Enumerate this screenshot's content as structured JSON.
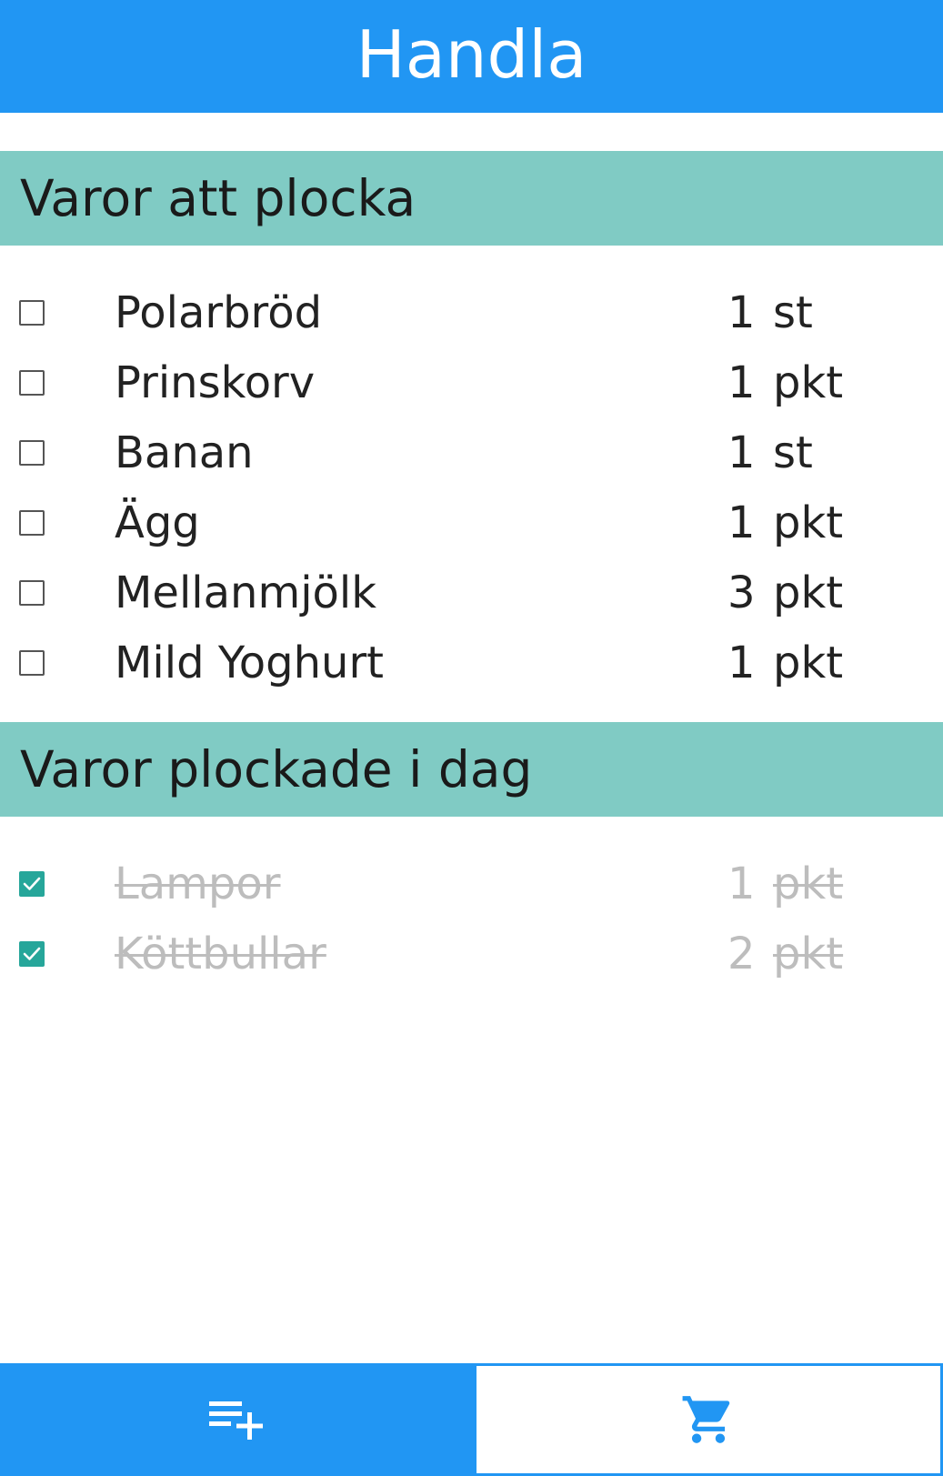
{
  "header": {
    "title": "Handla"
  },
  "to_pick": {
    "title": "Varor att plocka",
    "items": [
      {
        "name": "Polarbröd",
        "qty": "1",
        "unit": "st",
        "checked": false
      },
      {
        "name": "Prinskorv",
        "qty": "1",
        "unit": "pkt",
        "checked": false
      },
      {
        "name": "Banan",
        "qty": "1",
        "unit": "st",
        "checked": false
      },
      {
        "name": "Ägg",
        "qty": "1",
        "unit": "pkt",
        "checked": false
      },
      {
        "name": "Mellanmjölk",
        "qty": "3",
        "unit": "pkt",
        "checked": false
      },
      {
        "name": "Mild Yoghurt",
        "qty": "1",
        "unit": "pkt",
        "checked": false
      }
    ]
  },
  "picked_today": {
    "title": "Varor plockade i dag",
    "items": [
      {
        "name": "Lampor",
        "qty": "1",
        "unit": "pkt",
        "checked": true
      },
      {
        "name": "Köttbullar",
        "qty": "2",
        "unit": "pkt",
        "checked": true
      }
    ]
  },
  "bottom_nav": {
    "tabs": [
      {
        "icon": "playlist-add-icon",
        "active": true
      },
      {
        "icon": "shopping-cart-icon",
        "active": false
      }
    ]
  },
  "colors": {
    "primary": "#2196f3",
    "section": "#80cbc4",
    "check": "#26a69a",
    "done_text": "#bdbdbd"
  }
}
